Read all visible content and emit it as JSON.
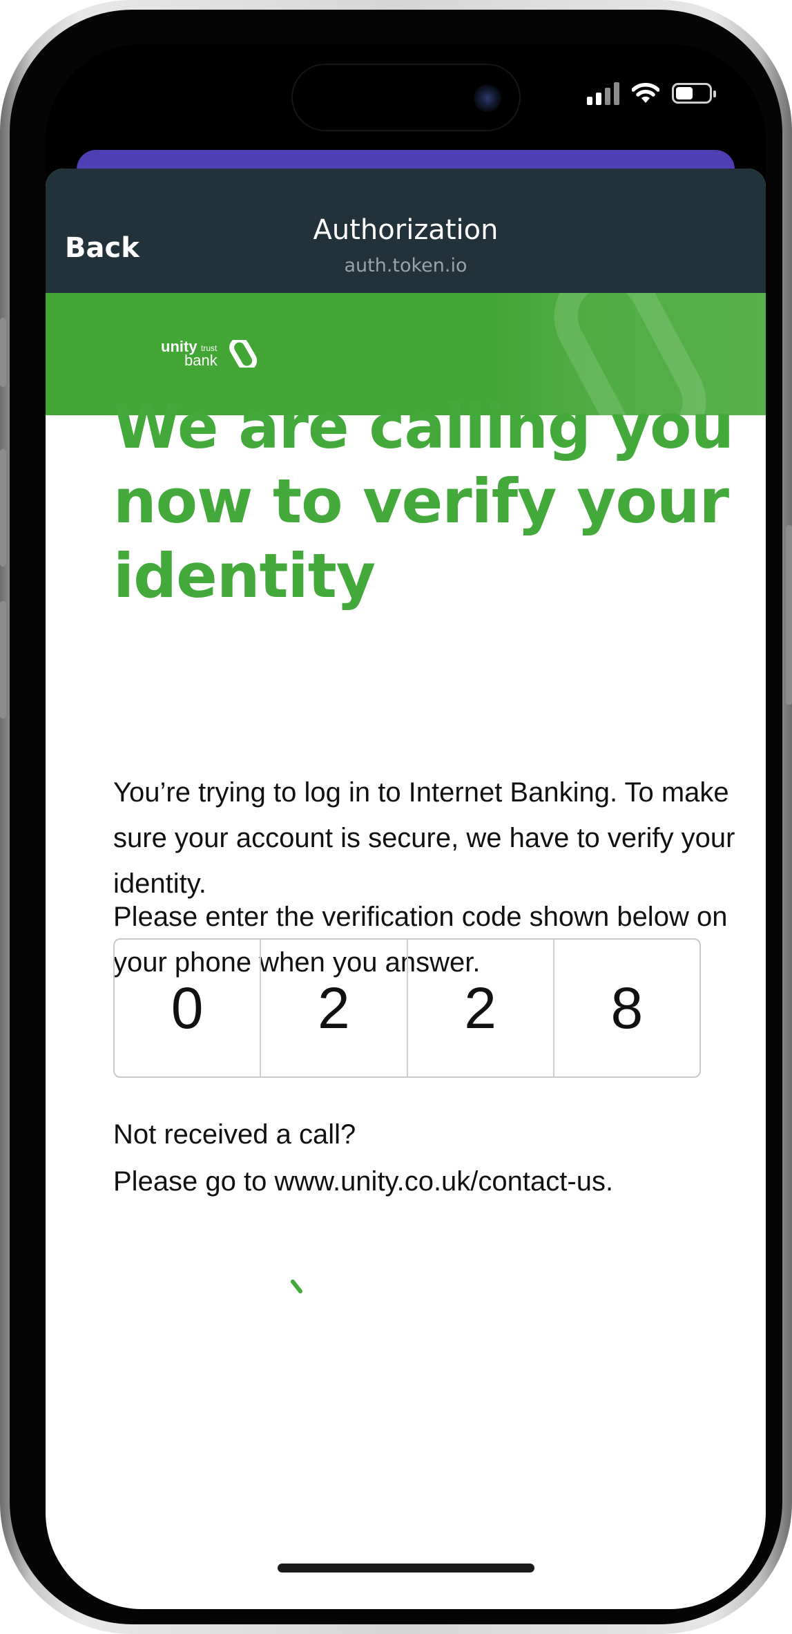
{
  "status_bar": {
    "icons": [
      "signal-icon",
      "wifi-icon",
      "battery-icon"
    ]
  },
  "nav": {
    "back_label": "Back",
    "title": "Authorization",
    "url": "auth.token.io"
  },
  "brand": {
    "logo_top": "unity",
    "logo_small": "trust",
    "logo_bottom": "bank",
    "green": "#41a634",
    "headline_green": "#42a93a",
    "nav_bg": "#22323b",
    "purple": "#4f3fb4"
  },
  "content": {
    "headline": "We are calling you now to verify your identity",
    "paragraph1": "You’re trying to log in to Internet Banking. To make sure your account is secure, we have to verify your identity.",
    "paragraph2": "Please enter the verification code shown below on your phone when you answer.",
    "code_digits": [
      "0",
      "2",
      "2",
      "8"
    ],
    "not_received": "Not received a call?",
    "contact_line": "Please go to www.unity.co.uk/contact-us."
  }
}
